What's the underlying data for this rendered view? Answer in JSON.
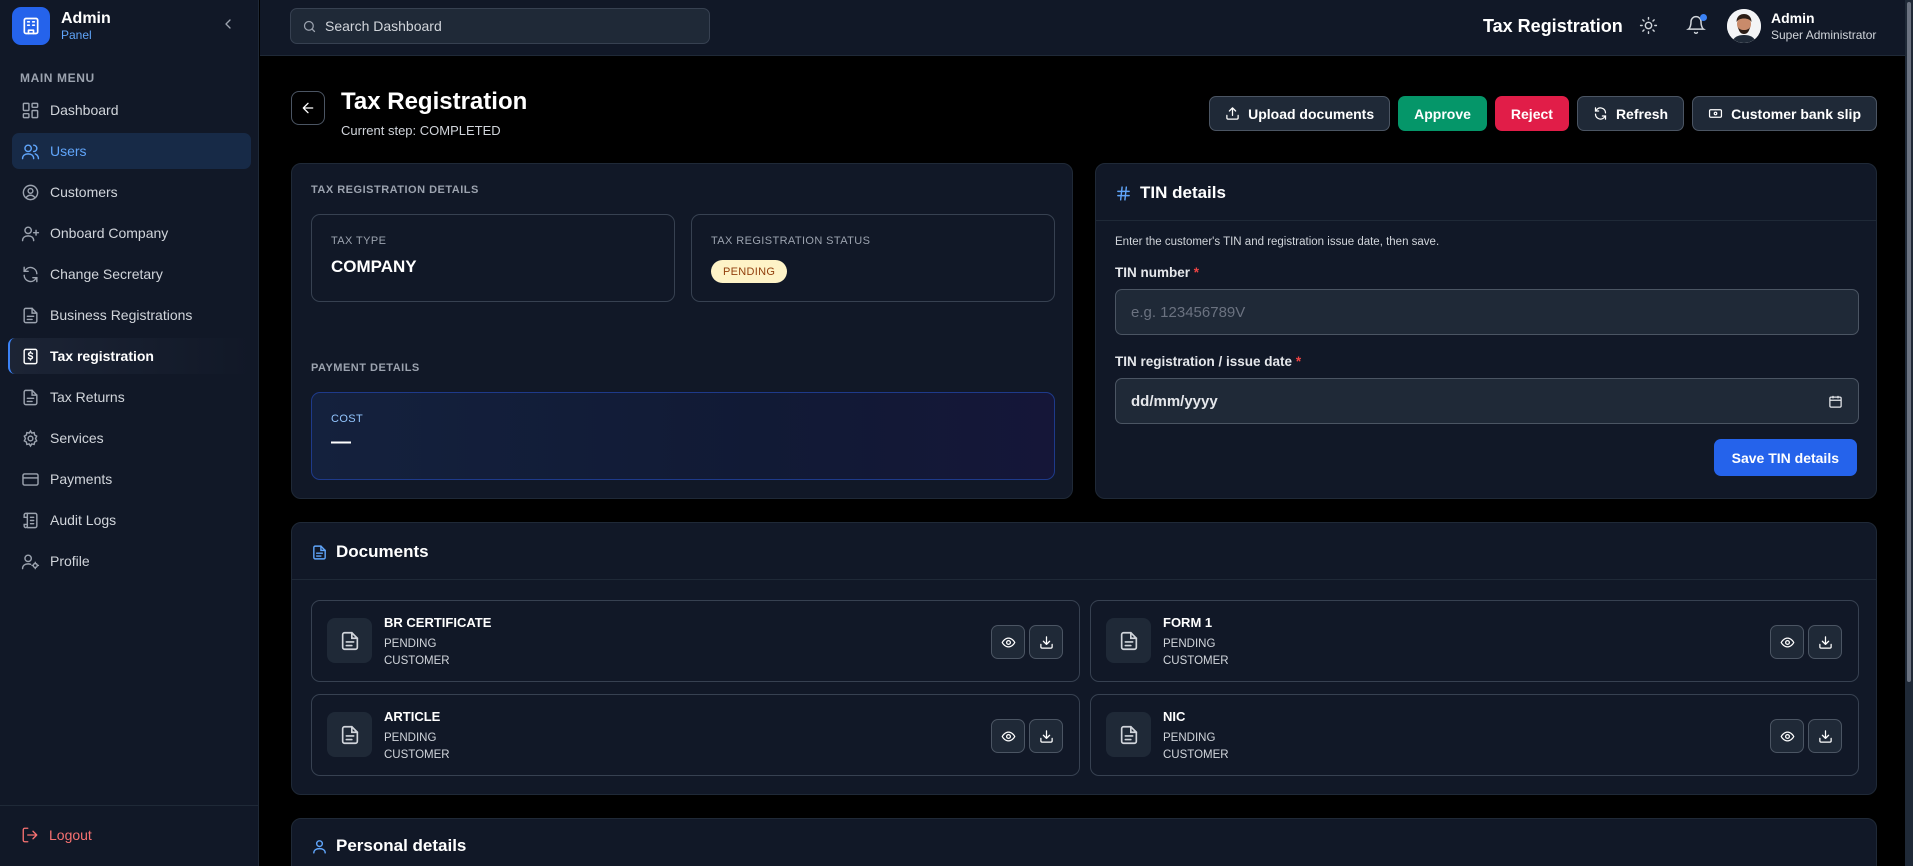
{
  "sidebar": {
    "brand_title": "Admin",
    "brand_subtitle": "Panel",
    "menu_heading": "MAIN MENU",
    "items": [
      {
        "label": "Dashboard"
      },
      {
        "label": "Users"
      },
      {
        "label": "Customers"
      },
      {
        "label": "Onboard Company"
      },
      {
        "label": "Change Secretary"
      },
      {
        "label": "Business Registrations"
      },
      {
        "label": "Tax registration"
      },
      {
        "label": "Tax Returns"
      },
      {
        "label": "Services"
      },
      {
        "label": "Payments"
      },
      {
        "label": "Audit Logs"
      },
      {
        "label": "Profile"
      }
    ],
    "logout_label": "Logout"
  },
  "topbar": {
    "search_placeholder": "Search Dashboard",
    "title": "Tax Registration",
    "user_name": "Admin",
    "user_role": "Super Administrator"
  },
  "page": {
    "title": "Tax Registration",
    "subtitle": "Current step: COMPLETED",
    "actions": {
      "upload": "Upload documents",
      "approve": "Approve",
      "reject": "Reject",
      "refresh": "Refresh",
      "bank_slip": "Customer bank slip"
    }
  },
  "details": {
    "heading": "TAX REGISTRATION DETAILS",
    "tax_type_label": "TAX TYPE",
    "tax_type_value": "COMPANY",
    "status_label": "TAX REGISTRATION STATUS",
    "status_value": "PENDING",
    "payment_heading": "PAYMENT DETAILS",
    "cost_label": "COST",
    "cost_value": "—"
  },
  "tin": {
    "title": "TIN details",
    "hint": "Enter the customer's TIN and registration issue date, then save.",
    "number_label": "TIN number",
    "number_placeholder": "e.g. 123456789V",
    "date_label": "TIN registration / issue date",
    "date_value": "dd/mm/yyyy",
    "required_mark": "*",
    "save_label": "Save TIN details"
  },
  "documents": {
    "title": "Documents",
    "items": [
      {
        "name": "BR CERTIFICATE",
        "status": "PENDING",
        "owner": "CUSTOMER"
      },
      {
        "name": "FORM 1",
        "status": "PENDING",
        "owner": "CUSTOMER"
      },
      {
        "name": "ARTICLE",
        "status": "PENDING",
        "owner": "CUSTOMER"
      },
      {
        "name": "NIC",
        "status": "PENDING",
        "owner": "CUSTOMER"
      }
    ]
  },
  "personal": {
    "title": "Personal details"
  },
  "colors": {
    "accent": "#2563eb",
    "approve": "#059669",
    "reject": "#e11d48",
    "pending_badge_bg": "#fef3c7"
  }
}
